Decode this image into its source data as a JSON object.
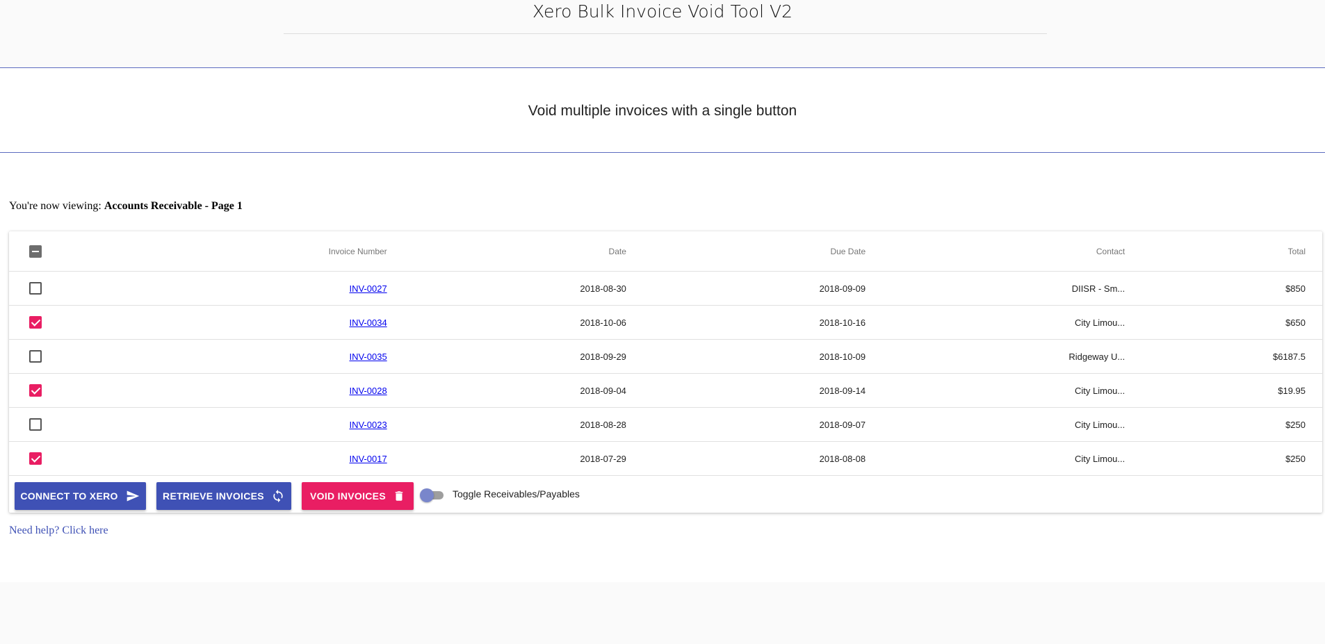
{
  "header": {
    "title": "Xero Bulk Invoice Void Tool V2",
    "subtitle": "Void multiple invoices with a single button"
  },
  "viewing": {
    "prefix": "You're now viewing:",
    "value": "Accounts Receivable - Page 1"
  },
  "table": {
    "columns": [
      "Invoice Number",
      "Date",
      "Due Date",
      "Contact",
      "Total"
    ],
    "rows": [
      {
        "invoice": "INV-0027",
        "date": "2018-08-30",
        "due": "2018-09-09",
        "contact": "DIISR - Sm...",
        "total": "$850",
        "checked": false
      },
      {
        "invoice": "INV-0034",
        "date": "2018-10-06",
        "due": "2018-10-16",
        "contact": "City Limou...",
        "total": "$650",
        "checked": true
      },
      {
        "invoice": "INV-0035",
        "date": "2018-09-29",
        "due": "2018-10-09",
        "contact": "Ridgeway U...",
        "total": "$6187.5",
        "checked": false
      },
      {
        "invoice": "INV-0028",
        "date": "2018-09-04",
        "due": "2018-09-14",
        "contact": "City Limou...",
        "total": "$19.95",
        "checked": true
      },
      {
        "invoice": "INV-0023",
        "date": "2018-08-28",
        "due": "2018-09-07",
        "contact": "City Limou...",
        "total": "$250",
        "checked": false
      },
      {
        "invoice": "INV-0017",
        "date": "2018-07-29",
        "due": "2018-08-08",
        "contact": "City Limou...",
        "total": "$250",
        "checked": true
      }
    ]
  },
  "actions": {
    "connect": "CONNECT TO XERO",
    "retrieve": "RETRIEVE INVOICES",
    "void": "VOID INVOICES",
    "toggle_label": "Toggle Receivables/Payables"
  },
  "help": "Need help? Click here",
  "colors": {
    "primary": "#3f51b5",
    "accent": "#e91e63"
  }
}
